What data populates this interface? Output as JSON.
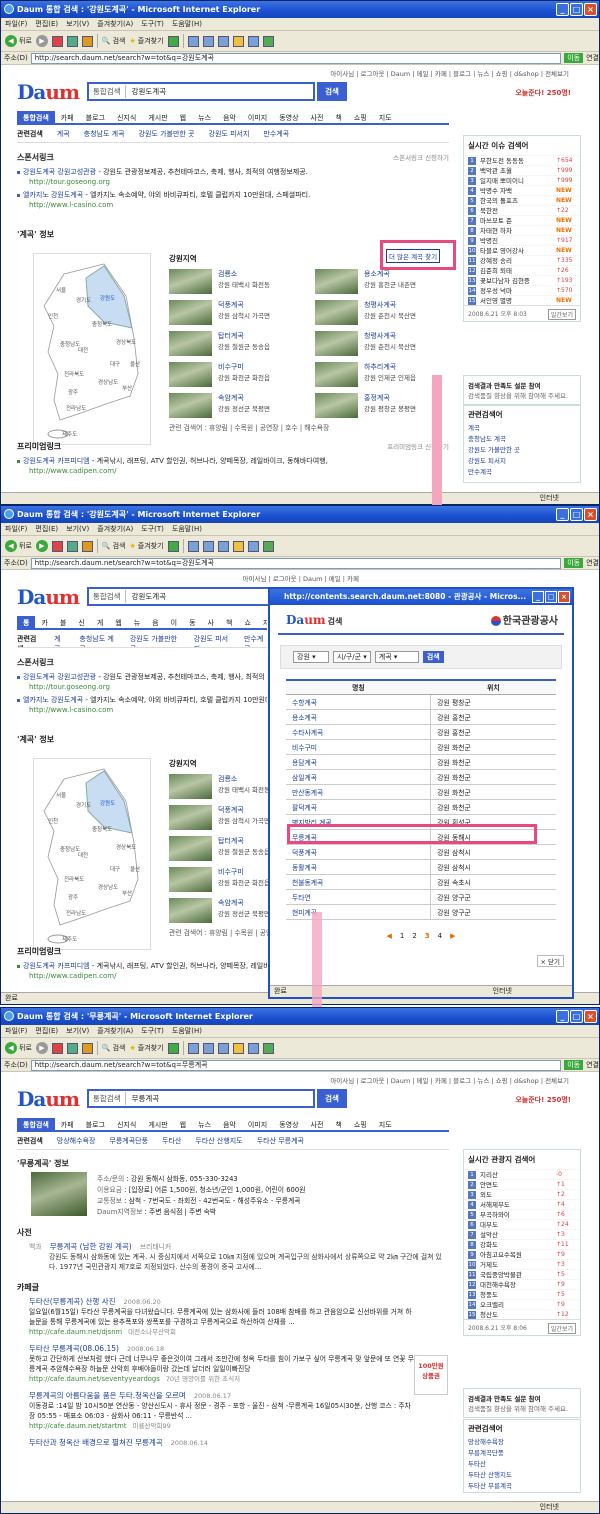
{
  "browser": {
    "title1": "Daum 통합 검색 : '강원도계곡' - Microsoft Internet Explorer",
    "title2": "Daum 통합 검색 : '강원도계곡' - Microsoft Internet Explorer",
    "title3": "Daum 통합 검색 : '무릉계곡' - Microsoft Internet Explorer",
    "menu": [
      "파일(F)",
      "편집(E)",
      "보기(V)",
      "즐겨찾기(A)",
      "도구(T)",
      "도움말(H)"
    ],
    "back": "뒤로",
    "search": "검색",
    "favorites": "즐겨찾기",
    "addr_label": "주소(D)",
    "url1": "http://search.daum.net/search?w=tot&q=강원도계곡",
    "url2": "http://search.daum.net/search?w=tot&q=강원도계곡",
    "url3": "http://search.daum.net/search?w=tot&q=무릉계곡",
    "go": "이동",
    "links": "연결",
    "status_done": "완료",
    "zone": "인터넷"
  },
  "daum": {
    "toplinks": "아이사님 | 로그아웃 | Daum | 메일 | 카페 | 블로그 | 뉴스 | 쇼핑 | d&shop | 전체보기",
    "toplinks_short": "아이사님 | 로그아웃 | Daum | 메일 | 카페",
    "logo_a": "Da",
    "logo_b": "um",
    "search_scope": "통합검색",
    "query1": "강원도계곡",
    "query3": "무릉계곡",
    "search_btn": "검색",
    "promo": "오늘준다! 250명!",
    "promo3": "오늘준다! 250명!",
    "tabs": [
      "통합검색",
      "카페",
      "블로그",
      "신지식",
      "게시판",
      "웹",
      "뉴스",
      "음악",
      "이미지",
      "동영상",
      "사전",
      "책",
      "쇼핑",
      "지도"
    ]
  },
  "shot1": {
    "related_h": "관련검색",
    "related": [
      "계곡",
      "충청남도 계곡",
      "강원도 가볼만한 곳",
      "강원도 피서지",
      "만수계곡"
    ],
    "sponsor_h": "스폰서링크",
    "sponsor_r": "스폰서링크 신청하기",
    "ads": [
      {
        "title": "강원도계곡 강원고성관광",
        "desc": "- 강원도 관광정보제공, 추천테마코스, 축제, 행사, 최적의 여행정보제공.",
        "url": "http://tour.goseong.org"
      },
      {
        "title": "엘카지노 강원도계곡",
        "desc": "- 엘카지노 속소예약, 야외 바비큐파티, 호텔 클럽카지 10만원대, 스페셜파티.",
        "url": "http://www.l-casino.com"
      }
    ],
    "info_h": "'계곡' 정보",
    "region_h": "강원지역",
    "find_btn": "더 많은 계곡 찾기",
    "map_labels": [
      "서울",
      "경기도",
      "강원도",
      "인천",
      "충청북도",
      "충청남도",
      "대전",
      "경상북도",
      "대구",
      "울산",
      "전라북도",
      "경상남도",
      "광주",
      "부산",
      "전라남도",
      "제주도"
    ],
    "spots": [
      {
        "name": "검룡소",
        "loc": "강원 태백시 화전동"
      },
      {
        "name": "용소계곡",
        "loc": "강원 홍천군 내촌면"
      },
      {
        "name": "덕풍계곡",
        "loc": "강원 삼척시 가곡면"
      },
      {
        "name": "청평사계곡",
        "loc": "강원 춘천시 북산면"
      },
      {
        "name": "탑터계곡",
        "loc": "강원 철원군 동송읍"
      },
      {
        "name": "청령사계곡",
        "loc": "강원 춘천시 북산면"
      },
      {
        "name": "비수구미",
        "loc": "강원 화천군 화천읍"
      },
      {
        "name": "하추리계곡",
        "loc": "강원 인제군 인제읍"
      },
      {
        "name": "속암계곡",
        "loc": "강원 정선군 북평면"
      },
      {
        "name": "홍정계곡",
        "loc": "강원 평창군 봉평면"
      }
    ],
    "related_terms": "관련 검색어 : 휴양림 | 수목원 | 공연장 | 호수 | 해수욕장",
    "premium_h": "프리미엄링크",
    "premium_r": "프리미엄링크 신청하기",
    "premium": {
      "title": "강원도계곡 카프피디엠",
      "desc": "- 계곡낚시, 래프팅, ATV 할인권, 허브나라, 양떼목장, 레일바이크, 동해바다여행,",
      "url": "http://www.cadipen.com/"
    },
    "issue_h": "실시간 이슈 검색어",
    "issues": [
      {
        "t": "무한도전 동동동",
        "c": "↑654"
      },
      {
        "t": "백악관 초월",
        "c": "↑999"
      },
      {
        "t": "일지매 뽀미이니",
        "c": "↑999"
      },
      {
        "t": "박명수 자백",
        "c": "NEW"
      },
      {
        "t": "한국의 돌포츠",
        "c": "NEW"
      },
      {
        "t": "북한전",
        "c": "↑22"
      },
      {
        "t": "마쓰모토 준",
        "c": "NEW"
      },
      {
        "t": "차태현 하차",
        "c": "NEW"
      },
      {
        "t": "박명진",
        "c": "↑917"
      },
      {
        "t": "타블로 영어강사",
        "c": "NEW"
      },
      {
        "t": "강혜정 송리",
        "c": "↑335"
      },
      {
        "t": "김준희 퇴태",
        "c": "↑26"
      },
      {
        "t": "꽃보다남자 김현중",
        "c": "↑193"
      },
      {
        "t": "정우성 넉마",
        "c": "↑570"
      },
      {
        "t": "서인영 별명",
        "c": "NEW"
      }
    ],
    "issue_time": "2008.6.21 오후 8:03",
    "issue_btn": "일간보기",
    "opt_title": "검색결과 만족도 설문 참여",
    "opt_desc": "검색품질 향상을 위해 참여해 주세요.",
    "rel_h": "관련검색어",
    "rel_items": [
      "계곡",
      "충청남도 계곡",
      "강원도 가볼만한 곳",
      "강원도 피서지",
      "만수계곡"
    ]
  },
  "shot2": {
    "popup_title": "http://contents.search.daum.net:8080 - 관광공사 - Micros...",
    "popup_logo_a": "Da",
    "popup_logo_b": "um",
    "popup_logo_c": "검색",
    "org": "한국관광공사",
    "filter": [
      "강원",
      "시/구/군",
      "계곡"
    ],
    "filter_btn": "검색",
    "col_name": "명칭",
    "col_loc": "위치",
    "rows": [
      {
        "n": "수항계곡",
        "l": "강원 평창군"
      },
      {
        "n": "용소계곡",
        "l": "강원 홍천군"
      },
      {
        "n": "수타사계곡",
        "l": "강원 홍천군"
      },
      {
        "n": "비수구미",
        "l": "강원 화천군"
      },
      {
        "n": "용담계곡",
        "l": "강원 화천군"
      },
      {
        "n": "삼일계곡",
        "l": "강원 화천군"
      },
      {
        "n": "만산동계곡",
        "l": "강원 화천군"
      },
      {
        "n": "팔덕계곡",
        "l": "강원 화천군"
      },
      {
        "n": "병지방리 계곡",
        "l": "강원 횡성군"
      },
      {
        "n": "무릉계곡",
        "l": "강원 동해시"
      },
      {
        "n": "덕풍계곡",
        "l": "강원 삼척시"
      },
      {
        "n": "동활계곡",
        "l": "강원 삼척시"
      },
      {
        "n": "천불동계곡",
        "l": "강원 속초시"
      },
      {
        "n": "두타연",
        "l": "강원 양구군"
      },
      {
        "n": "현미계곡",
        "l": "강원 양구군"
      }
    ],
    "pages": [
      "1",
      "2",
      "3",
      "4"
    ],
    "close": "닫기"
  },
  "shot3": {
    "related_h": "관련검색",
    "related": [
      "망상해수욕장",
      "무릉계곡단풍",
      "두타산",
      "두타산 산행지도",
      "두타산 무릉계곡"
    ],
    "info_h": "'무릉계곡' 정보",
    "info": [
      {
        "k": "주소/문의",
        "v": ": 강원 동해시 삼화동, 055-330-3243"
      },
      {
        "k": "이용요금",
        "v": ": [입장료] 어른 1,500원, 청소년/군인 1,000원, 어린이 600원"
      },
      {
        "k": "교통정보",
        "v": ": 삼척 - 7번국도 - 좌회전 - 42번국도 - 해성주유소 - 무릉계곡"
      },
      {
        "k": "Daum지역정보",
        "v": ": 주변 음식점 | 주변 숙박"
      }
    ],
    "dict_h": "사전",
    "dict_tag": "백과",
    "dict_title": "무릉계곡 (남한 강원 계곡)",
    "dict_src": "브리태니커",
    "dict_body": "강원도 동해시 삼화동에 있는 계곡. 시 중심지에서 서쪽으로 10㎞ 지점에 있으며 계곡입구의 삼화사에서 상류쪽으로 약 2㎞ 구간에 걸쳐 있다. 1977년 국민관광지 제7호로 지정되었다. 산수의 풍경이 중국 고사에...",
    "cafe_h": "카페글",
    "cafes": [
      {
        "t": "두타산(무릉계곡) 산행 사진",
        "d": "2008.06.20",
        "b": "일요일(6월15일) 두타산 무릉계곡을 다녀왔습니다. 무릉계곡에 있는 삼화사에 들러 108배 참배를 하고 관음암으로 신선바위를 거쳐 하늘문을 통해 무릉계곡에 있는 용추폭포와 쌍폭포를 구경하고 무릉계곡으로 하산하여 산채를 ...",
        "u": "http://cafe.daum.net/djsnm",
        "s": "대전소나무산악회"
      },
      {
        "t": "두타산 무릉계곡(08.06.15)",
        "d": "2008.06.18",
        "b": "못하고 간단하게 산보처럼 했다 근데 너무나무 좋은것이여 그래서 조만간에 청옥 두타를 힘이 가보구 싶어 무릉계곡 맞 앞문에 또 연꽃 무릉계곡 추암해수욕장 하늘문 산악회 후배야들이랑 갔는데 날더러 일일이빠진당",
        "u": "http://cafe.daum.net/seventyyeardogs",
        "s": "70년 영양이를 위한 초식처"
      },
      {
        "t": "무릉계곡의 아름다움을 품은 두타.청옥산을 오르며",
        "d": "2008.06.17",
        "b": "이동경로 :14일 밤 10시50분 연산동 - 양산신도시 - 휴사 정문 - 경주 - 포항 - 울진 - 삼척 -무릉계곡 16일05시30분, 산행 코스 : 주차장 05:55 - 매표소 06:03 - 삼화사 06:11 - 무릉반석 ...",
        "u": "http://cafe.daum.net/startmt",
        "s": "미룡산악회99"
      },
      {
        "t": "두타산과 청옥산 배경으로 펼쳐진 무릉계곡",
        "d": "2008.06.14",
        "b": "",
        "u": "",
        "s": ""
      }
    ],
    "ad_badge": "100만원 상품권",
    "tour_h": "실시간 관광지 검색어",
    "tour": [
      {
        "t": "지리산",
        "c": "-0"
      },
      {
        "t": "안면도",
        "c": "↑1"
      },
      {
        "t": "외도",
        "c": "↑2"
      },
      {
        "t": "서해제부도",
        "c": "↑4"
      },
      {
        "t": "부곡하와이",
        "c": "↑6"
      },
      {
        "t": "대부도",
        "c": "↑24"
      },
      {
        "t": "설악산",
        "c": "↑3"
      },
      {
        "t": "강화도",
        "c": "↑11"
      },
      {
        "t": "아침고요수목원",
        "c": "↑9"
      },
      {
        "t": "거제도",
        "c": "↑3"
      },
      {
        "t": "국립중앙박물관",
        "c": "↑5"
      },
      {
        "t": "대천해수욕장",
        "c": "↑9"
      },
      {
        "t": "청풍도",
        "c": "↑5"
      },
      {
        "t": "오크밸리",
        "c": "↑9"
      },
      {
        "t": "청산도",
        "c": "↑12"
      }
    ],
    "tour_time": "2008.6.21 오후 8:06",
    "rel_items": [
      "망상해수욕장",
      "무릉계곡단풍",
      "두타산",
      "두타산 산행지도",
      "두타산 무릉계곡"
    ]
  },
  "colors": {
    "accent": "#3a5fd0",
    "highlight": "#e84a80",
    "arrow": "#f4a6c0"
  }
}
